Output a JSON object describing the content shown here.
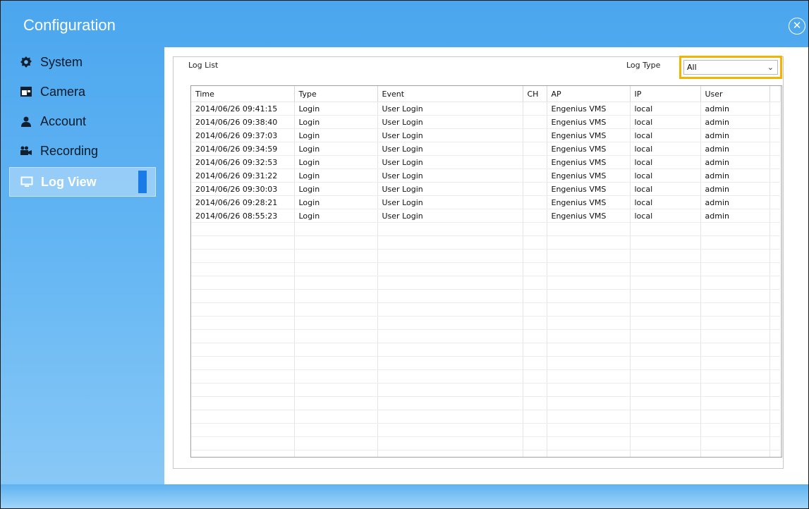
{
  "window": {
    "title": "Configuration"
  },
  "sidebar": {
    "items": [
      {
        "label": "System",
        "icon": "gear-icon",
        "active": false
      },
      {
        "label": "Camera",
        "icon": "camera-icon",
        "active": false
      },
      {
        "label": "Account",
        "icon": "user-icon",
        "active": false
      },
      {
        "label": "Recording",
        "icon": "recording-icon",
        "active": false
      },
      {
        "label": "Log View",
        "icon": "monitor-icon",
        "active": true
      }
    ]
  },
  "log": {
    "group_label": "Log List",
    "type_label": "Log Type",
    "type_value": "All",
    "columns": [
      "Time",
      "Type",
      "Event",
      "CH",
      "AP",
      "IP",
      "User"
    ],
    "rows": [
      [
        "2014/06/26 09:41:15",
        "Login",
        "User Login",
        "",
        "Engenius VMS",
        "local",
        "admin"
      ],
      [
        "2014/06/26 09:38:40",
        "Login",
        "User Login",
        "",
        "Engenius VMS",
        "local",
        "admin"
      ],
      [
        "2014/06/26 09:37:03",
        "Login",
        "User Login",
        "",
        "Engenius VMS",
        "local",
        "admin"
      ],
      [
        "2014/06/26 09:34:59",
        "Login",
        "User Login",
        "",
        "Engenius VMS",
        "local",
        "admin"
      ],
      [
        "2014/06/26 09:32:53",
        "Login",
        "User Login",
        "",
        "Engenius VMS",
        "local",
        "admin"
      ],
      [
        "2014/06/26 09:31:22",
        "Login",
        "User Login",
        "",
        "Engenius VMS",
        "local",
        "admin"
      ],
      [
        "2014/06/26 09:30:03",
        "Login",
        "User Login",
        "",
        "Engenius VMS",
        "local",
        "admin"
      ],
      [
        "2014/06/26 09:28:21",
        "Login",
        "User Login",
        "",
        "Engenius VMS",
        "local",
        "admin"
      ],
      [
        "2014/06/26 08:55:23",
        "Login",
        "User Login",
        "",
        "Engenius VMS",
        "local",
        "admin"
      ]
    ]
  },
  "colors": {
    "accent": "#1a7ae6",
    "highlight": "#f5b300",
    "titlebar": "#4ba6ee"
  }
}
